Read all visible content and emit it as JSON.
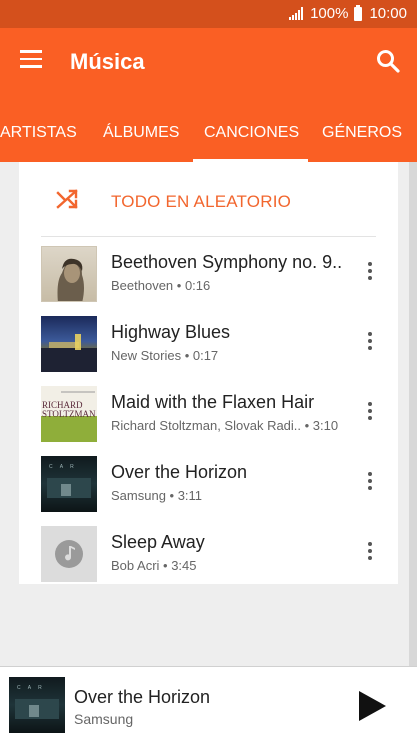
{
  "status": {
    "battery": "100%",
    "time": "10:00"
  },
  "header": {
    "title": "Música"
  },
  "tabs": [
    {
      "label": "ARTISTAS",
      "active": false
    },
    {
      "label": "ÁLBUMES",
      "active": false
    },
    {
      "label": "CANCIONES",
      "active": true
    },
    {
      "label": "GÉNEROS",
      "active": false
    }
  ],
  "shuffle": {
    "label": "TODO EN ALEATORIO",
    "icon": "shuffle-icon"
  },
  "songs": [
    {
      "title": "Beethoven Symphony no. 9..",
      "subtitle": "Beethoven • 0:16"
    },
    {
      "title": "Highway Blues",
      "subtitle": "New Stories • 0:17"
    },
    {
      "title": "Maid with the Flaxen Hair",
      "subtitle": "Richard Stoltzman, Slovak Radi.. • 3:10",
      "art_text": [
        "RICHARD",
        "STOLTZMAN"
      ]
    },
    {
      "title": "Over the Horizon",
      "subtitle": "Samsung • 3:11"
    },
    {
      "title": "Sleep Away",
      "subtitle": "Bob Acri • 3:45"
    }
  ],
  "now_playing": {
    "title": "Over the Horizon",
    "artist": "Samsung"
  },
  "colors": {
    "status_bar": "#d4501c",
    "app_bar": "#fa5f24",
    "accent": "#f2662e"
  }
}
